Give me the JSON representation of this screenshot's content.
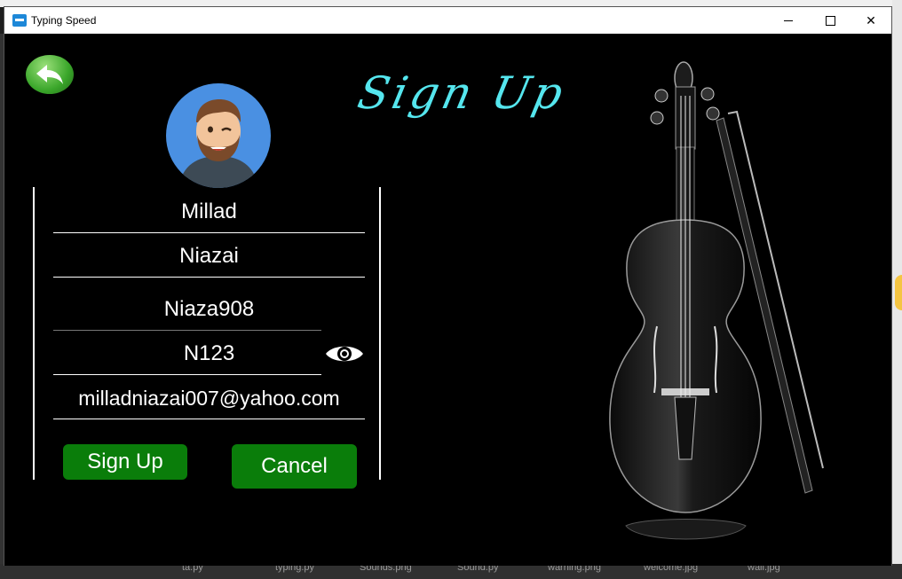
{
  "window": {
    "title": "Typing Speed",
    "controls": {
      "minimize": "",
      "maximize": "",
      "close": "✕"
    }
  },
  "page": {
    "heading": "Sign Up"
  },
  "form": {
    "first_name": "Millad",
    "last_name": "Niazai",
    "username": "Niaza908",
    "password": "N123",
    "email": "milladniazai007@yahoo.com",
    "signup_label": "Sign Up",
    "cancel_label": "Cancel"
  },
  "icons": {
    "back": "back-arrow-icon",
    "avatar": "user-avatar-icon",
    "eye": "eye-icon",
    "app": "keyboard-icon",
    "decor": "violin-image"
  },
  "colors": {
    "background": "#000000",
    "heading": "#55e6ee",
    "button": "#0a7d0a",
    "avatar_bg": "#4a90e2"
  },
  "taskbar": {
    "items": [
      "ta.py",
      "typing.py",
      "Sounds.png",
      "Sound.py",
      "warning.png",
      "welcome.jpg",
      "wall.jpg"
    ]
  }
}
